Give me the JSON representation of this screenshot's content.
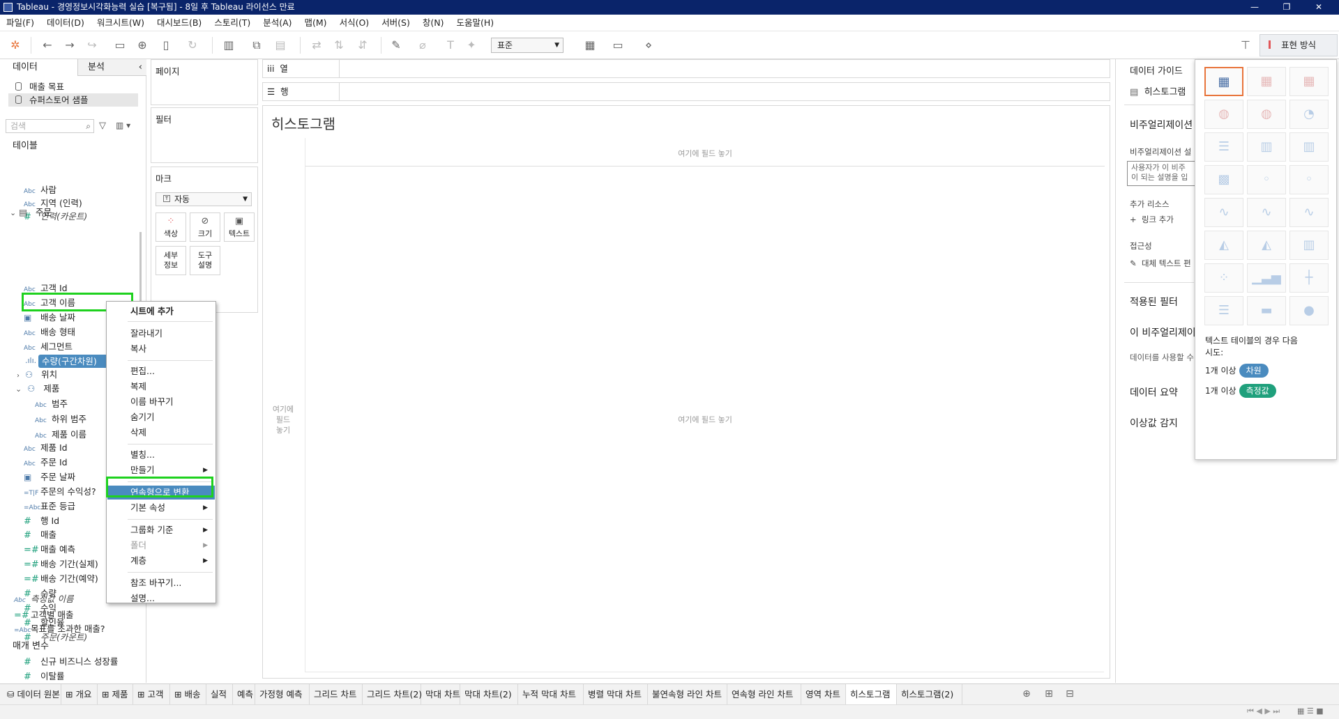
{
  "window": {
    "title": "Tableau - 경영정보시각화능력 실습 [복구됨] - 8일 후 Tableau 라이선스 만료",
    "min": "—",
    "max": "❐",
    "close": "✕"
  },
  "menu": [
    "파일(F)",
    "데이터(D)",
    "워크시트(W)",
    "대시보드(B)",
    "스토리(T)",
    "분석(A)",
    "맵(M)",
    "서식(O)",
    "서버(S)",
    "창(N)",
    "도움말(H)"
  ],
  "toolbar": {
    "fit_value": "표준",
    "show_me_label": "표현 방식"
  },
  "left": {
    "tab_data": "데이터",
    "tab_analysis": "분석",
    "datasources": [
      "매출 목표",
      "슈퍼스토어 샘플"
    ],
    "search_placeholder": "검색",
    "tables_header": "테이블",
    "people_fields": [
      {
        "type": "Abc",
        "name": "사람"
      },
      {
        "type": "Abc",
        "name": "지역 (인력)"
      },
      {
        "type": "#",
        "name": "인력(카운트)"
      }
    ],
    "order_folder": "주문",
    "order_fields": [
      {
        "type": "Abc",
        "name": "고객 Id"
      },
      {
        "type": "Abc",
        "name": "고객 이름"
      },
      {
        "type": "▣",
        "name": "배송 날짜"
      },
      {
        "type": "Abc",
        "name": "배송 형태"
      },
      {
        "type": "Abc",
        "name": "세그먼트"
      }
    ],
    "selected_field": "수량(구간차원)",
    "location_folder": "위치",
    "product_folder": "제품",
    "product_fields": [
      {
        "type": "Abc",
        "name": "범주"
      },
      {
        "type": "Abc",
        "name": "하위 범주"
      },
      {
        "type": "Abc",
        "name": "제품 이름"
      }
    ],
    "order_fields2": [
      {
        "type": "Abc",
        "name": "제품 Id"
      },
      {
        "type": "Abc",
        "name": "주문 Id"
      },
      {
        "type": "▣",
        "name": "주문 날짜"
      },
      {
        "type": "=T|F",
        "name": "주문의 수익성?"
      },
      {
        "type": "=Abc",
        "name": "표준 등급"
      },
      {
        "type": "#",
        "name": "행 Id"
      },
      {
        "type": "#",
        "name": "매출"
      },
      {
        "type": "=#",
        "name": "매출 예측"
      },
      {
        "type": "=#",
        "name": "배송 기간(실제)"
      },
      {
        "type": "=#",
        "name": "배송 기간(예약)"
      },
      {
        "type": "#",
        "name": "수량"
      },
      {
        "type": "#",
        "name": "수익"
      },
      {
        "type": "#",
        "name": "할인율"
      },
      {
        "type": "#",
        "name": "주문(카운트)"
      }
    ],
    "measure_names": "측정값 이름",
    "extra_fields": [
      {
        "type": "=#",
        "name": "고객별 매출"
      },
      {
        "type": "=Abc",
        "name": "목표를 초과한 매출?"
      }
    ],
    "params_header": "매개 변수",
    "params": [
      {
        "type": "#",
        "name": "신규 비즈니스 성장률"
      },
      {
        "type": "#",
        "name": "이탈률"
      }
    ]
  },
  "shelves": {
    "pages": "페이지",
    "filters": "필터",
    "marks": "마크",
    "mark_type": "자동",
    "mark_buttons": [
      "색상",
      "크기",
      "텍스트",
      "세부\n정보",
      "도구\n설명"
    ],
    "columns": "열",
    "rows": "행"
  },
  "view": {
    "title": "히스토그램",
    "drop_top": "여기에 필드 놓기",
    "drop_center": "여기에 필드 놓기",
    "drop_left": "여기에\n필드\n놓기"
  },
  "context_menu": {
    "items": [
      "시트에 추가",
      "잘라내기",
      "복사",
      "편집...",
      "복제",
      "이름 바꾸기",
      "숨기기",
      "삭제",
      "별칭...",
      "만들기",
      "연속형으로 변환",
      "기본 속성",
      "그룹화 기준",
      "폴더",
      "계층",
      "참조 바꾸기...",
      "설명..."
    ]
  },
  "guide": {
    "title": "데이터 가이드",
    "sheet": "히스토그램",
    "viz_desc_header": "비주얼리제이션",
    "viz_desc_label": "비주얼리제이션 설",
    "viz_desc_box": "사용자가 이 비주\n이 되는 설명을 입",
    "resources": "추가 리소스",
    "add_link": "링크 추가",
    "accessibility": "접근성",
    "alt_text": "대체 텍스트 편",
    "filters": "적용된 필터",
    "this_viz": "이 비주얼리제이",
    "this_viz_sub": "데이터를 사용할 수",
    "summary": "데이터 요약",
    "outliers": "이상값 감지"
  },
  "showme": {
    "hint": "텍스트 테이블의 경우 다음\n시도:",
    "req1_prefix": "1개 이상",
    "req1": "차원",
    "req2_prefix": "1개 이상",
    "req2": "측정값",
    "colors": {
      "dim": "#4a8bbf",
      "measure": "#1fa07c",
      "selected": "#e8743b"
    }
  },
  "sheets": [
    "데이터 원본",
    "개요",
    "제품",
    "고객",
    "배송",
    "실적",
    "예측",
    "가정형 예측",
    "그리드 차트",
    "그리드 차트(2)",
    "막대 차트",
    "막대 차트(2)",
    "누적 막대 차트",
    "병렬 막대 차트",
    "불연속형 라인 차트",
    "연속형 라인 차트",
    "영역 차트",
    "히스토그램",
    "히스토그램(2)"
  ],
  "active_sheet": "히스토그램"
}
